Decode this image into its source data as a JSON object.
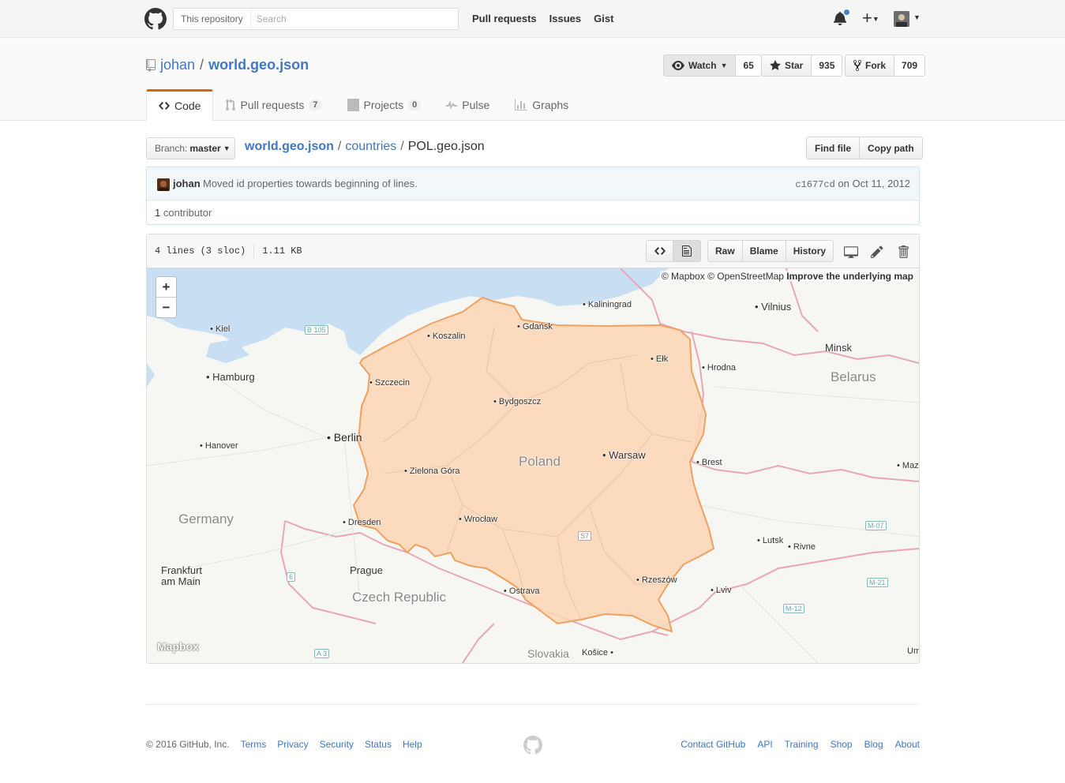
{
  "header": {
    "scope_label": "This repository",
    "search_placeholder": "Search",
    "nav": [
      "Pull requests",
      "Issues",
      "Gist"
    ],
    "plus": "+"
  },
  "repo": {
    "owner": "johan",
    "separator": "/",
    "name": "world.geo.json",
    "watch": {
      "label": "Watch",
      "count": "65"
    },
    "star": {
      "label": "Star",
      "count": "935"
    },
    "fork": {
      "label": "Fork",
      "count": "709"
    }
  },
  "reponav": {
    "code": "Code",
    "pulls": "Pull requests",
    "pulls_count": "7",
    "projects": "Projects",
    "projects_count": "0",
    "pulse": "Pulse",
    "graphs": "Graphs"
  },
  "filenav": {
    "branch_label": "Branch:",
    "branch_value": "master",
    "crumbs": {
      "root": "world.geo.json",
      "sep": "/",
      "folder": "countries",
      "file": "POL.geo.json"
    },
    "find_file": "Find file",
    "copy_path": "Copy path"
  },
  "commit": {
    "author": "johan",
    "message": "Moved id properties towards beginning of lines.",
    "sha": "c1677cd",
    "date_prefix": "on",
    "date": "Oct 11, 2012",
    "contributors_count": "1",
    "contributors_label": "contributor"
  },
  "file": {
    "lines": "4 lines (3 sloc)",
    "size": "1.11 KB",
    "raw": "Raw",
    "blame": "Blame",
    "history": "History"
  },
  "map": {
    "attribution_mapbox": "© Mapbox",
    "attribution_osm": "© OpenStreetMap",
    "attribution_improve": "Improve the underlying map",
    "zoom_in": "+",
    "zoom_out": "−",
    "logo": "Mapbox",
    "fill_color": "#fcd5b5",
    "stroke_color": "#f0a060",
    "labels": {
      "kiel": "Kiel",
      "hamburg": "Hamburg",
      "hanover": "Hanover",
      "berlin": "Berlin",
      "germany": "Germany",
      "dresden": "Dresden",
      "frankfurt": "Frankfurt\nam Main",
      "prague": "Prague",
      "czech": "Czech Republic",
      "slovakia": "Slovakia",
      "kosice": "Košice",
      "kaliningrad": "Kaliningrad",
      "vilnius": "Vilnius",
      "minsk": "Minsk",
      "belarus": "Belarus",
      "hrodna": "Hrodna",
      "brest": "Brest",
      "maz": "Maz",
      "lutsk": "Lutsk",
      "rivne": "Rivne",
      "lviv": "Lviv",
      "um": "Um",
      "koszalin": "Koszalin",
      "gdansk": "Gdańsk",
      "elk": "Ełk",
      "szczecin": "Szczecin",
      "bydgoszcz": "Bydgoszcz",
      "poland": "Poland",
      "warsaw": "Warsaw",
      "zielona": "Zielona Góra",
      "wroclaw": "Wrocław",
      "ostrava": "Ostrava",
      "rzeszow": "Rzeszów",
      "b105": "B 105",
      "s7": "S7",
      "m07": "M-07",
      "m21": "M-21",
      "m12": "M-12",
      "r6": "6",
      "a3": "A 3"
    }
  },
  "footer": {
    "copyright": "© 2016 GitHub, Inc.",
    "left_links": [
      "Terms",
      "Privacy",
      "Security",
      "Status",
      "Help"
    ],
    "right_links": [
      "Contact GitHub",
      "API",
      "Training",
      "Shop",
      "Blog",
      "About"
    ]
  }
}
